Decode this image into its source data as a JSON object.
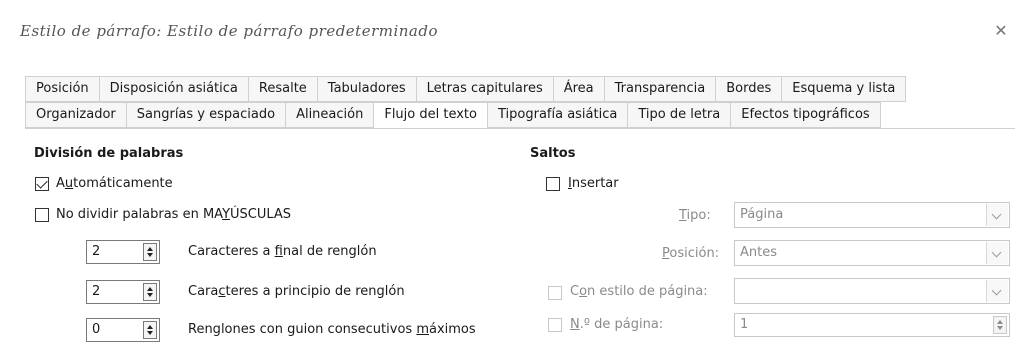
{
  "window": {
    "title": "Estilo de párrafo: Estilo de párrafo predeterminado",
    "close_glyph": "✕"
  },
  "tabs_row1": [
    "Posición",
    "Disposición asiática",
    "Resalte",
    "Tabuladores",
    "Letras capitulares",
    "Área",
    "Transparencia",
    "Bordes",
    "Esquema y lista"
  ],
  "tabs_row2": [
    "Organizador",
    "Sangrías y espaciado",
    "Alineación",
    "Flujo del texto",
    "Tipografía asiática",
    "Tipo de letra",
    "Efectos tipográficos"
  ],
  "active_tab": "Flujo del texto",
  "hyphenation": {
    "heading": "División de palabras",
    "automatic": {
      "pre": "A",
      "key": "u",
      "post": "tomáticamente",
      "checked": true
    },
    "no_caps": {
      "pre": "No dividir palabras en MA",
      "key": "Y",
      "post": "ÚSCULAS",
      "checked": false
    },
    "end_chars": {
      "value": "2",
      "pre": "Caracteres a ",
      "key": "f",
      "post": "inal de renglón"
    },
    "start_chars": {
      "value": "2",
      "pre": "Cara",
      "key": "c",
      "post": "teres a principio de renglón"
    },
    "max_hyphens": {
      "value": "0",
      "pre": "Renglones con guion consecutivos ",
      "key": "m",
      "post": "áximos"
    }
  },
  "breaks": {
    "heading": "Saltos",
    "insert": {
      "key": "I",
      "post": "nsertar",
      "checked": false
    },
    "type": {
      "key": "T",
      "post": "ipo:",
      "value": "Página"
    },
    "position": {
      "key": "P",
      "post": "osición:",
      "value": "Antes"
    },
    "page_style": {
      "pre": "C",
      "key": "o",
      "post": "n estilo de página:",
      "value": ""
    },
    "page_number": {
      "key": "N",
      "post": ".º de página:",
      "value": "1"
    }
  }
}
